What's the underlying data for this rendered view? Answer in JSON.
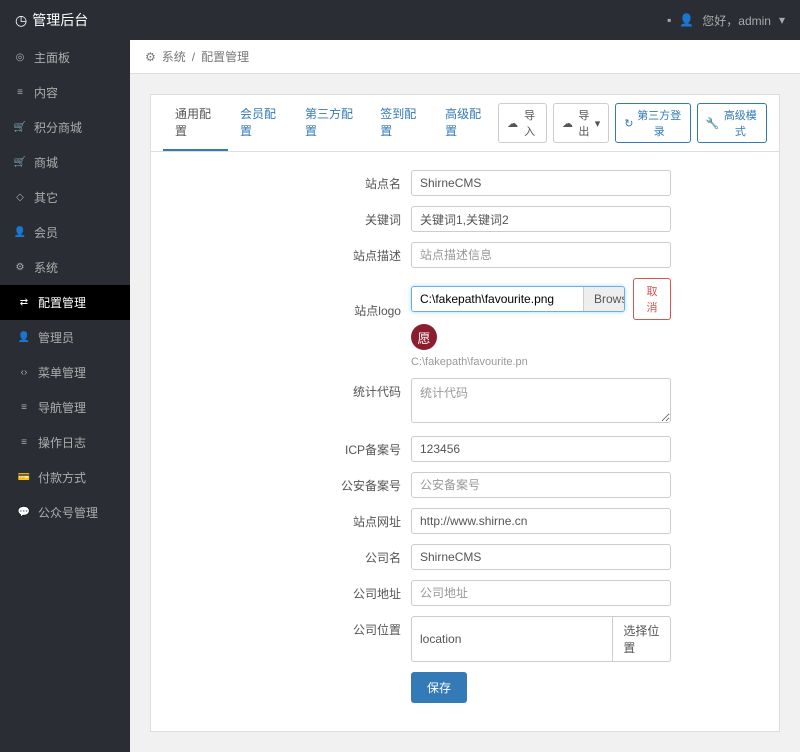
{
  "topbar": {
    "brand": "管理后台",
    "greeting": "您好，admin"
  },
  "sidebar": {
    "items": [
      {
        "label": "主面板",
        "icon": "◎"
      },
      {
        "label": "内容",
        "icon": "≡"
      },
      {
        "label": "积分商城",
        "icon": "🛒"
      },
      {
        "label": "商城",
        "icon": "🛒"
      },
      {
        "label": "其它",
        "icon": "◇"
      },
      {
        "label": "会员",
        "icon": "👤"
      },
      {
        "label": "系统",
        "icon": "⚙"
      }
    ],
    "sub": [
      {
        "label": "配置管理",
        "icon": "⇄",
        "active": true
      },
      {
        "label": "管理员",
        "icon": "👤"
      },
      {
        "label": "菜单管理",
        "icon": "‹›"
      },
      {
        "label": "导航管理",
        "icon": "≡"
      },
      {
        "label": "操作日志",
        "icon": "≡"
      },
      {
        "label": "付款方式",
        "icon": "💳"
      },
      {
        "label": "公众号管理",
        "icon": "💬"
      }
    ]
  },
  "breadcrumb": {
    "root": "系统",
    "current": "配置管理"
  },
  "tabs": [
    "通用配置",
    "会员配置",
    "第三方配置",
    "签到配置",
    "高级配置"
  ],
  "actions": {
    "import": "导入",
    "export": "导出",
    "third_login": "第三方登录",
    "adv_mode": "高级模式"
  },
  "form": {
    "site_name": {
      "label": "站点名",
      "value": "ShirneCMS"
    },
    "keywords": {
      "label": "关键词",
      "value": "关键词1,关键词2"
    },
    "description": {
      "label": "站点描述",
      "placeholder": "站点描述信息"
    },
    "logo": {
      "label": "站点logo",
      "path": "C:\\fakepath\\favourite.png",
      "browse": "Browse",
      "cancel": "取消",
      "preview_text": "C:\\fakepath\\favourite.pn"
    },
    "stats": {
      "label": "统计代码",
      "placeholder": "统计代码"
    },
    "icp": {
      "label": "ICP备案号",
      "value": "123456"
    },
    "police": {
      "label": "公安备案号",
      "placeholder": "公安备案号"
    },
    "url": {
      "label": "站点网址",
      "value": "http://www.shirne.cn"
    },
    "company": {
      "label": "公司名",
      "value": "ShirneCMS"
    },
    "address": {
      "label": "公司地址",
      "placeholder": "公司地址"
    },
    "location": {
      "label": "公司位置",
      "value": "location",
      "button": "选择位置"
    },
    "save": "保存"
  }
}
